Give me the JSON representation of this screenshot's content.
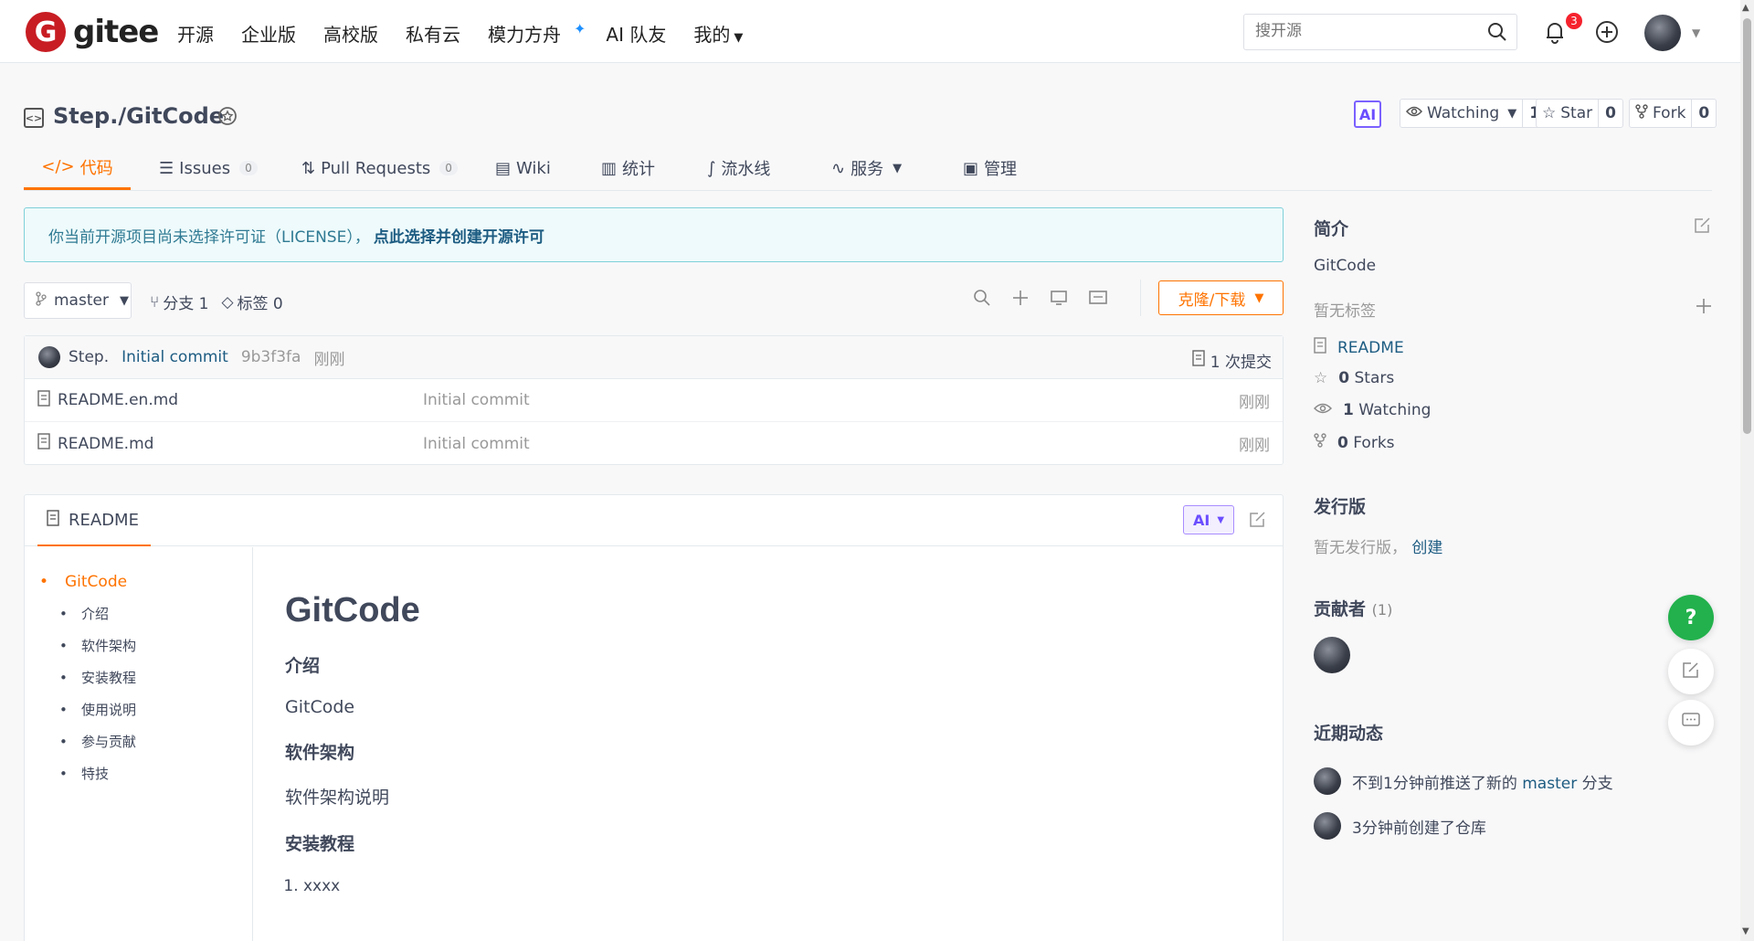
{
  "nav": {
    "logo_letter": "G",
    "logo_text": "gitee",
    "links": [
      "开源",
      "企业版",
      "高校版",
      "私有云",
      "模力方舟",
      "AI 队友",
      "我的"
    ],
    "search_placeholder": "搜开源",
    "notification_count": "3"
  },
  "repo": {
    "title": "Step./GitCode",
    "ai_label": "AI",
    "watching_label": "Watching",
    "watching_count": "1",
    "star_label": "Star",
    "star_count": "0",
    "fork_label": "Fork",
    "fork_count": "0"
  },
  "tabs": [
    {
      "label": "代码",
      "count": ""
    },
    {
      "label": "Issues",
      "count": "0"
    },
    {
      "label": "Pull Requests",
      "count": "0"
    },
    {
      "label": "Wiki",
      "count": ""
    },
    {
      "label": "统计",
      "count": ""
    },
    {
      "label": "流水线",
      "count": ""
    },
    {
      "label": "服务",
      "count": ""
    },
    {
      "label": "管理",
      "count": ""
    }
  ],
  "license": {
    "text": "你当前开源项目尚未选择许可证（LICENSE），",
    "link": "点此选择并创建开源许可"
  },
  "branch": {
    "name": "master",
    "branches": "分支 1",
    "tags": "标签 0",
    "clone_label": "克隆/下载"
  },
  "commit": {
    "author": "Step.",
    "message": "Initial commit",
    "sha": "9b3f3fa",
    "time": "刚刚",
    "count_label": "1 次提交"
  },
  "files": [
    {
      "name": "README.en.md",
      "message": "Initial commit",
      "time": "刚刚"
    },
    {
      "name": "README.md",
      "message": "Initial commit",
      "time": "刚刚"
    }
  ],
  "readme": {
    "tab_label": "README",
    "ai_label": "AI",
    "toc": [
      "GitCode",
      "介绍",
      "软件架构",
      "安装教程",
      "使用说明",
      "参与贡献",
      "特技"
    ],
    "h1": "GitCode",
    "sec1_title": "介绍",
    "sec1_body": "GitCode",
    "sec2_title": "软件架构",
    "sec2_body": "软件架构说明",
    "sec3_title": "安装教程",
    "list_item": "xxxx"
  },
  "sidebar": {
    "intro_title": "简介",
    "intro_desc": "GitCode",
    "no_tags": "暂无标签",
    "readme_link": "README",
    "stars_count": "0",
    "stars_label": "Stars",
    "watching_count": "1",
    "watching_label": "Watching",
    "forks_count": "0",
    "forks_label": "Forks",
    "release_title": "发行版",
    "release_text": "暂无发行版，",
    "release_create": "创建",
    "contributors_title": "贡献者",
    "contributors_count": "(1)",
    "activity_title": "近期动态",
    "activity1_prefix": "不到1分钟前推送了新的",
    "activity1_branch": "master",
    "activity1_suffix": "分支",
    "activity2": "3分钟前创建了仓库"
  },
  "colors": {
    "accent": "#fe7300",
    "brand_red": "#c71d23",
    "link": "#1d5c82",
    "help_button": "#22b14c"
  }
}
